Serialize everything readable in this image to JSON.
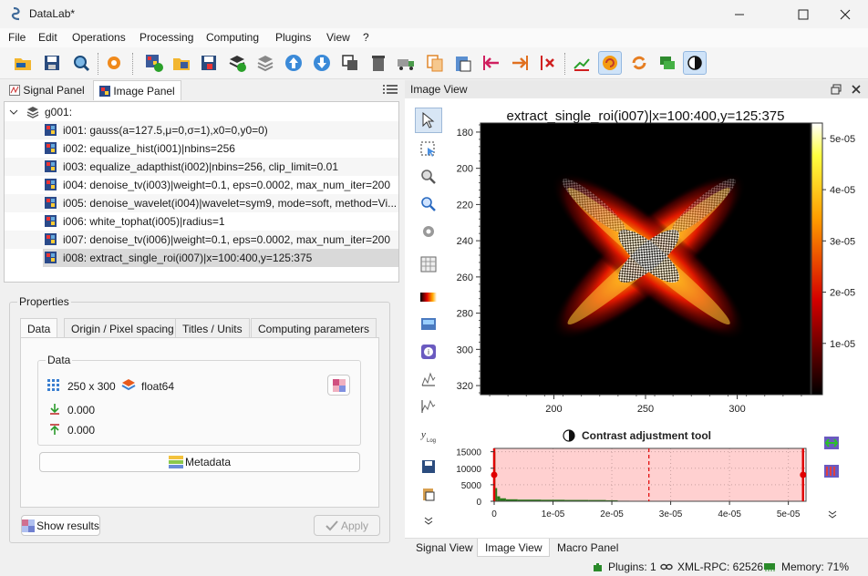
{
  "window": {
    "title": "DataLab*"
  },
  "menu": [
    "File",
    "Edit",
    "Operations",
    "Processing",
    "Computing",
    "Plugins",
    "View",
    "?"
  ],
  "left_tabs": {
    "signal": "Signal Panel",
    "image": "Image Panel"
  },
  "tree": {
    "group": "g001:",
    "items": [
      "i001: gauss(a=127.5,μ=0,σ=1),x0=0,y0=0)",
      "i002: equalize_hist(i001)|nbins=256",
      "i003: equalize_adapthist(i002)|nbins=256, clip_limit=0.01",
      "i004: denoise_tv(i003)|weight=0.1, eps=0.0002, max_num_iter=200",
      "i005: denoise_wavelet(i004)|wavelet=sym9, mode=soft, method=Vi...",
      "i006: white_tophat(i005)|radius=1",
      "i007: denoise_tv(i006)|weight=0.1, eps=0.0002, max_num_iter=200",
      "i008: extract_single_roi(i007)|x=100:400,y=125:375"
    ],
    "selected_index": 7
  },
  "properties": {
    "title": "Properties",
    "tabs": [
      "Data",
      "Origin / Pixel spacing",
      "Titles / Units",
      "Computing parameters"
    ],
    "group_title": "Data",
    "size": "250 x 300",
    "dtype": "float64",
    "min": "0.000",
    "max": "0.000",
    "metadata_button": "Metadata",
    "show_results_button": "Show results",
    "apply_button": "Apply"
  },
  "image_view": {
    "header": "Image View",
    "bottom_tabs": [
      "Signal View",
      "Image View",
      "Macro Panel"
    ],
    "contrast_title": "Contrast adjustment tool"
  },
  "status": {
    "plugins": "Plugins: 1",
    "xmlrpc": "XML-RPC: 62526",
    "memory": "Memory: 71%"
  },
  "chart_data": [
    {
      "type": "heatmap",
      "title": "extract_single_roi(i007)|x=100:400,y=125:375",
      "xlabel": "",
      "ylabel": "",
      "x_ticks": [
        200,
        250,
        300
      ],
      "y_ticks": [
        180,
        200,
        220,
        240,
        260,
        280,
        300,
        320
      ],
      "xlim": [
        160,
        340
      ],
      "ylim": [
        175,
        325
      ],
      "colormap": "hot",
      "colorbar_ticks": [
        "1e-05",
        "2e-05",
        "3e-05",
        "4e-05",
        "5e-05"
      ],
      "colorbar_range": [
        0,
        5.3e-05
      ],
      "pattern": "X-shaped cross of two diagonal bands, brightest near the centre"
    },
    {
      "type": "bar",
      "title": "Contrast adjustment tool",
      "xlabel": "",
      "ylabel": "",
      "x_ticks": [
        "0",
        "1e-05",
        "2e-05",
        "3e-05",
        "4e-05",
        "5e-05"
      ],
      "y_ticks": [
        0,
        5000,
        10000,
        15000
      ],
      "xlim": [
        0,
        5.3e-05
      ],
      "ylim": [
        0,
        16000
      ],
      "bins": [
        {
          "x": 0.0,
          "y": 15000
        },
        {
          "x": 2e-07,
          "y": 4000
        },
        {
          "x": 5e-07,
          "y": 1500
        },
        {
          "x": 1e-06,
          "y": 900
        },
        {
          "x": 2e-06,
          "y": 600
        },
        {
          "x": 4e-06,
          "y": 500
        },
        {
          "x": 8e-06,
          "y": 450
        },
        {
          "x": 1.2e-05,
          "y": 400
        },
        {
          "x": 1.6e-05,
          "y": 380
        },
        {
          "x": 1.9e-05,
          "y": 300
        },
        {
          "x": 2.1e-05,
          "y": 150
        }
      ],
      "range_min": 0.0,
      "range_max": 5.25e-05,
      "midpoint": 2.63e-05
    }
  ],
  "colors": {
    "accent": "#0078d4",
    "selection": "#d9d9d9",
    "histogram_fill": "#ffd0d0",
    "range_marker": "#e00000"
  }
}
